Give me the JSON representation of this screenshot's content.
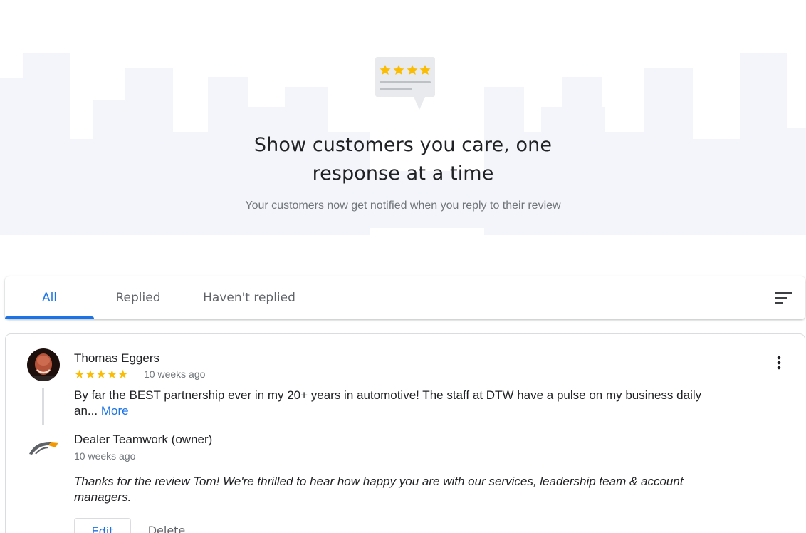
{
  "hero": {
    "title_line1": "Show customers you care, one",
    "title_line2": "response at a time",
    "subtitle": "Your customers now get notified when you reply to their review",
    "icon": "review-stars-bubble-icon"
  },
  "tabs": {
    "items": [
      {
        "label": "All",
        "active": true
      },
      {
        "label": "Replied",
        "active": false
      },
      {
        "label": "Haven't replied",
        "active": false
      }
    ],
    "sort_icon": "sort-icon"
  },
  "review": {
    "reviewer_name": "Thomas Eggers",
    "stars": "★★★★★",
    "rating": 5,
    "time": "10 weeks ago",
    "text": "By far the BEST partnership ever in my 20+ years in automotive! The staff at DTW have a pulse on my business daily an...",
    "more_label": "More",
    "menu_icon": "more-vert-icon",
    "reply": {
      "owner_name": "Dealer Teamwork (owner)",
      "time": "10 weeks ago",
      "text": "Thanks for the review Tom! We're thrilled to hear how happy you are with our services, leadership team & account managers.",
      "edit_label": "Edit",
      "delete_label": "Delete"
    }
  },
  "colors": {
    "accent": "#1a73e8",
    "star": "#fbbc04",
    "secondary_text": "#70757a",
    "skyline": "#f7f8fb"
  }
}
